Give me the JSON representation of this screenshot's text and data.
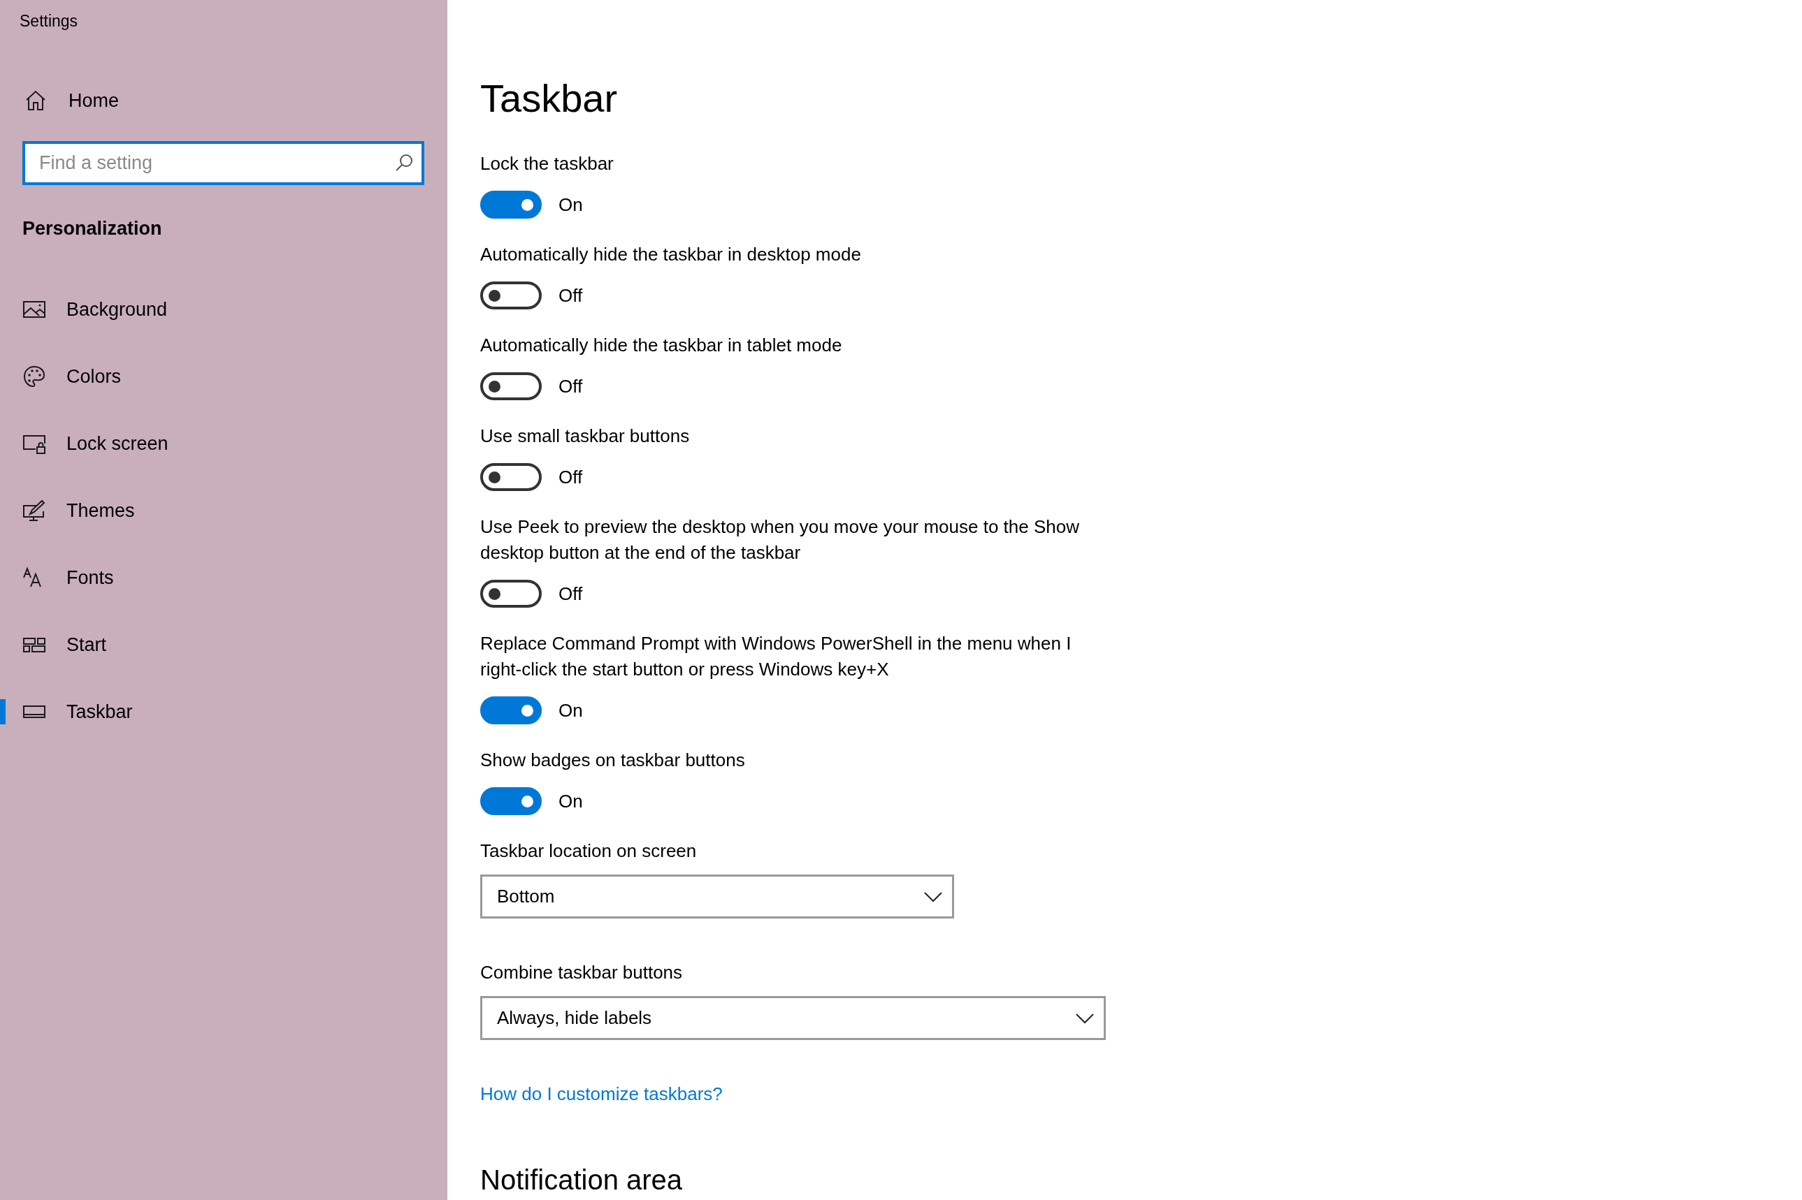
{
  "window": {
    "title": "Settings"
  },
  "sidebar": {
    "home": "Home",
    "search": {
      "placeholder": "Find a setting"
    },
    "section": "Personalization",
    "items": [
      {
        "kind": "background",
        "label": "Background",
        "selected": false
      },
      {
        "kind": "colors",
        "label": "Colors",
        "selected": false
      },
      {
        "kind": "lockscreen",
        "label": "Lock screen",
        "selected": false
      },
      {
        "kind": "themes",
        "label": "Themes",
        "selected": false
      },
      {
        "kind": "fonts",
        "label": "Fonts",
        "selected": false
      },
      {
        "kind": "start",
        "label": "Start",
        "selected": false
      },
      {
        "kind": "taskbar",
        "label": "Taskbar",
        "selected": true
      }
    ]
  },
  "page": {
    "title": "Taskbar",
    "settings": [
      {
        "kind": "toggle",
        "label": "Lock the taskbar",
        "on": true,
        "state_text": "On"
      },
      {
        "kind": "toggle",
        "label": "Automatically hide the taskbar in desktop mode",
        "on": false,
        "state_text": "Off"
      },
      {
        "kind": "toggle",
        "label": "Automatically hide the taskbar in tablet mode",
        "on": false,
        "state_text": "Off"
      },
      {
        "kind": "toggle",
        "label": "Use small taskbar buttons",
        "on": false,
        "state_text": "Off"
      },
      {
        "kind": "toggle",
        "label": "Use Peek to preview the desktop when you move your mouse to the Show desktop button at the end of the taskbar",
        "on": false,
        "state_text": "Off"
      },
      {
        "kind": "toggle",
        "label": "Replace Command Prompt with Windows PowerShell in the menu when I right-click the start button or press Windows key+X",
        "on": true,
        "state_text": "On"
      },
      {
        "kind": "toggle",
        "label": "Show badges on taskbar buttons",
        "on": true,
        "state_text": "On"
      },
      {
        "kind": "dropdown",
        "label": "Taskbar location on screen",
        "value": "Bottom"
      },
      {
        "kind": "dropdown",
        "label": "Combine taskbar buttons",
        "value": "Always, hide labels"
      }
    ],
    "link": "How do I customize taskbars?",
    "section_heading": "Notification area"
  }
}
